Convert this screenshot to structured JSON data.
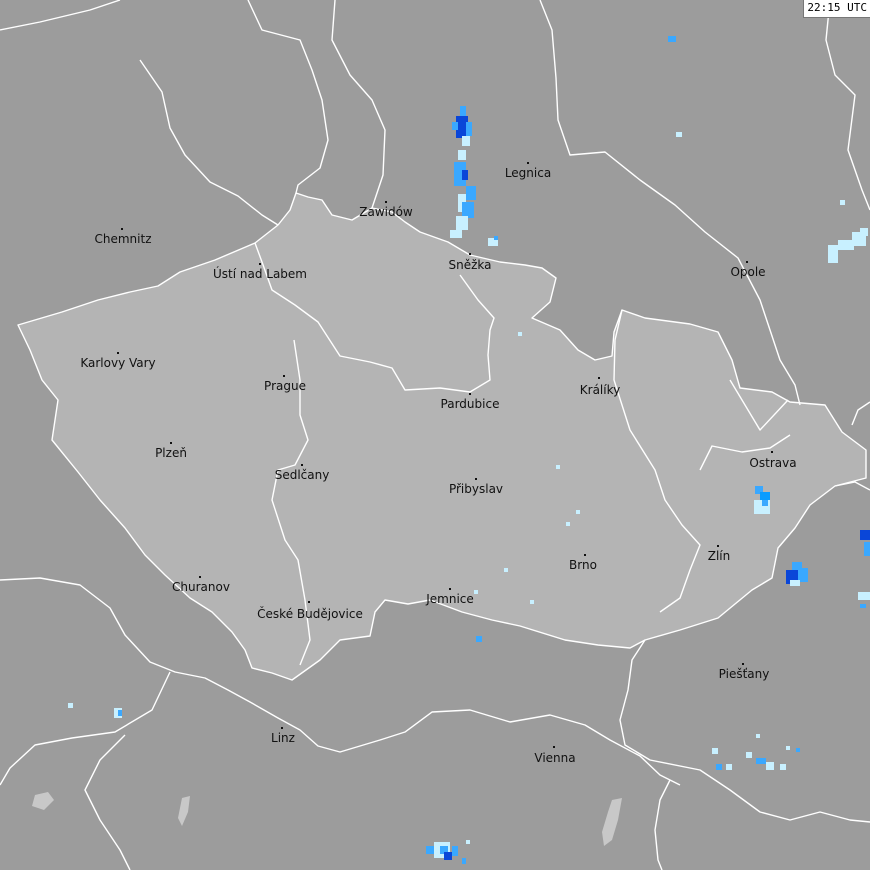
{
  "map": {
    "timestamp": "22:15 UTC",
    "colors": {
      "background": "#9c9c9c",
      "highlighted_country": "#b4b4b4",
      "borders": "#ffffff",
      "radar_light": "#c8f0ff",
      "radar_medium": "#3aa8ff",
      "radar_dark": "#0a46d8"
    },
    "cities": [
      {
        "name": "Chemnitz"
      },
      {
        "name": "Zawidów"
      },
      {
        "name": "Legnica"
      },
      {
        "name": "Ústí nad Labem"
      },
      {
        "name": "Sněžka"
      },
      {
        "name": "Opole"
      },
      {
        "name": "Karlovy Vary"
      },
      {
        "name": "Prague"
      },
      {
        "name": "Pardubice"
      },
      {
        "name": "Králíky"
      },
      {
        "name": "Plzeň"
      },
      {
        "name": "Ostrava"
      },
      {
        "name": "Sedlčany"
      },
      {
        "name": "Přibyslav"
      },
      {
        "name": "Zlín"
      },
      {
        "name": "Brno"
      },
      {
        "name": "Churanov"
      },
      {
        "name": "Jemnice"
      },
      {
        "name": "České Budějovice"
      },
      {
        "name": "Piešťany"
      },
      {
        "name": "Linz"
      },
      {
        "name": "Vienna"
      }
    ]
  }
}
